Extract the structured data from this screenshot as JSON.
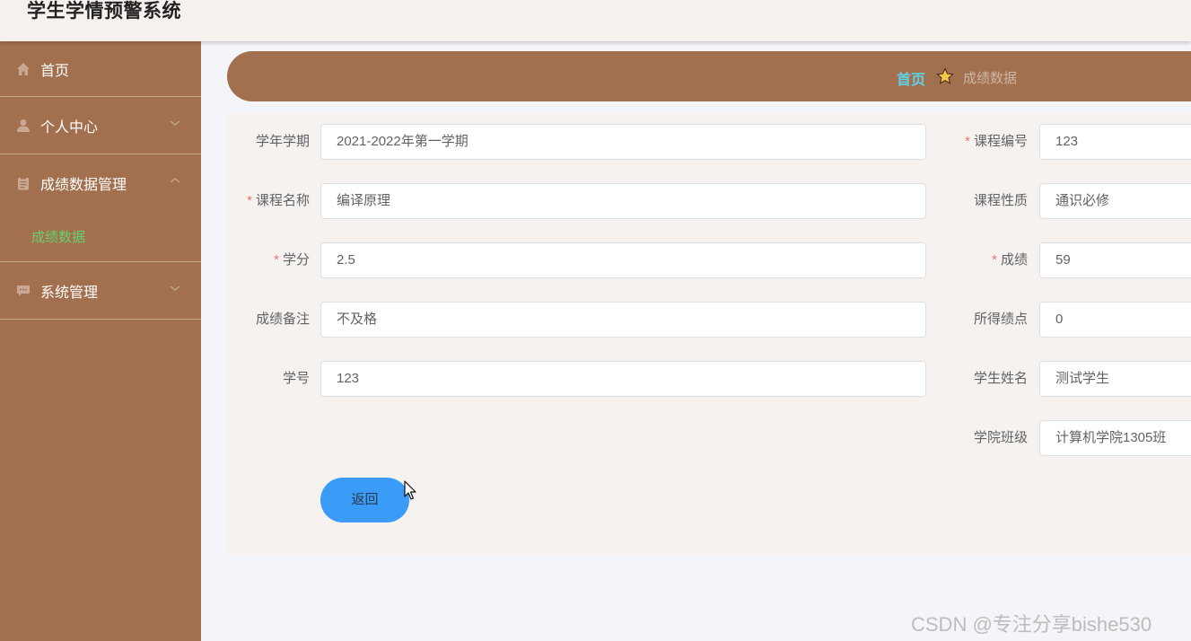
{
  "app": {
    "title": "学生学情预警系统"
  },
  "sidebar": {
    "items": [
      {
        "label": "首页",
        "icon": "home-icon"
      },
      {
        "label": "个人中心",
        "icon": "user-icon"
      },
      {
        "label": "成绩数据管理",
        "icon": "clipboard-icon",
        "children": [
          {
            "label": "成绩数据"
          }
        ]
      },
      {
        "label": "系统管理",
        "icon": "chat-icon"
      }
    ]
  },
  "breadcrumb": {
    "home": "首页",
    "current": "成绩数据"
  },
  "form": {
    "left": [
      {
        "label": "学年学期",
        "required": false,
        "value": "2021-2022年第一学期"
      },
      {
        "label": "课程名称",
        "required": true,
        "value": "编译原理"
      },
      {
        "label": "学分",
        "required": true,
        "value": "2.5"
      },
      {
        "label": "成绩备注",
        "required": false,
        "value": "不及格"
      },
      {
        "label": "学号",
        "required": false,
        "value": "123"
      }
    ],
    "right": [
      {
        "label": "课程编号",
        "required": true,
        "value": "123"
      },
      {
        "label": "课程性质",
        "required": false,
        "value": "通识必修"
      },
      {
        "label": "成绩",
        "required": true,
        "value": "59"
      },
      {
        "label": "所得绩点",
        "required": false,
        "value": "0"
      },
      {
        "label": "学生姓名",
        "required": false,
        "value": "测试学生"
      },
      {
        "label": "学院班级",
        "required": false,
        "value": "计算机学院1305班"
      }
    ],
    "back_label": "返回"
  },
  "watermark": "CSDN @专注分享bishe530",
  "colors": {
    "sidebar": "#a2704f",
    "active_submenu": "#67d26a",
    "breadcrumb_home": "#5ed3e6",
    "button": "#3a9cf7",
    "required": "#f56c6c"
  }
}
